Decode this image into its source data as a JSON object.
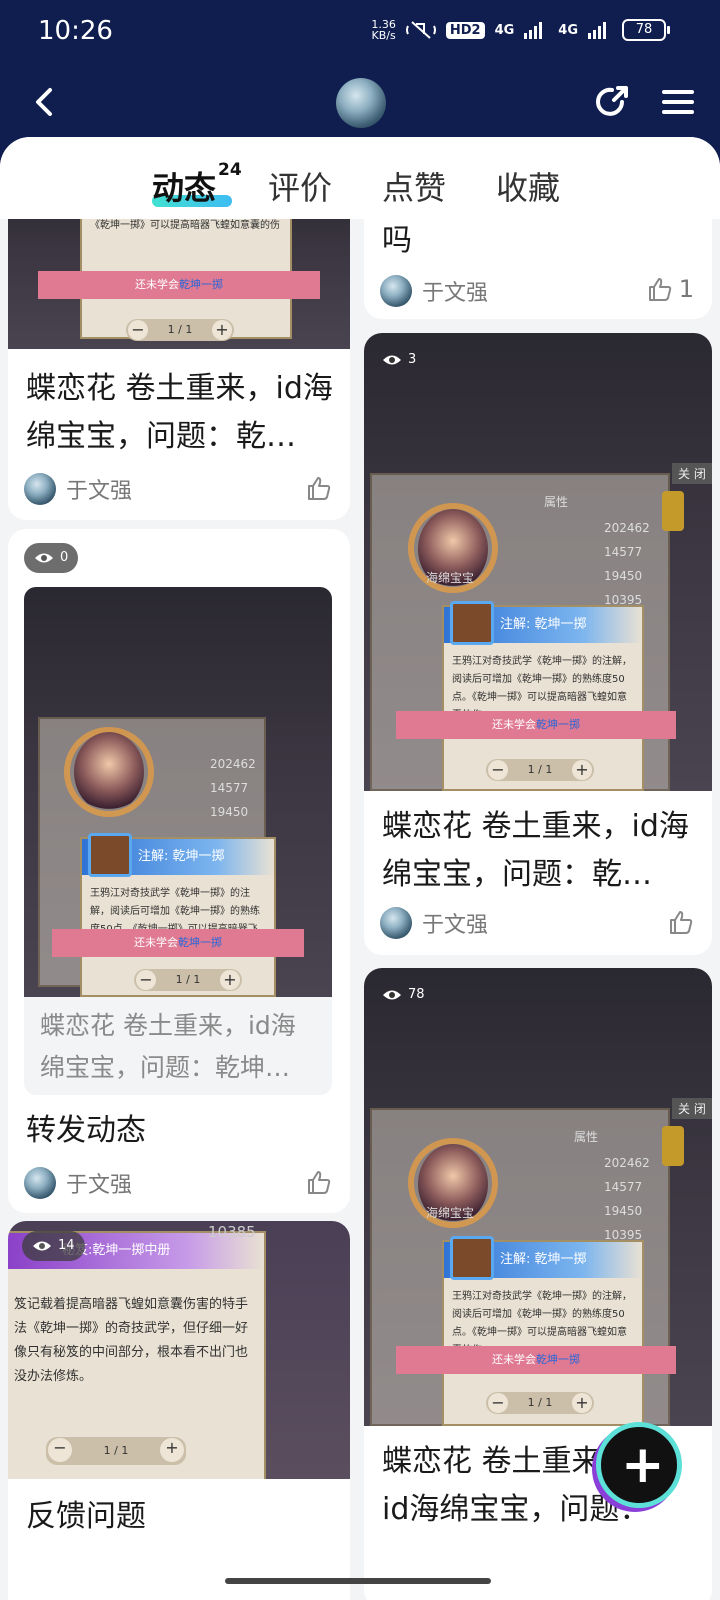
{
  "status_bar": {
    "time": "10:26",
    "net_speed_value": "1.36",
    "net_speed_unit": "KB/s",
    "hd": "HD2",
    "signal1": "4G",
    "signal2": "4G",
    "battery": "78"
  },
  "tabs": [
    {
      "label": "动态",
      "badge": "24",
      "active": true
    },
    {
      "label": "评价"
    },
    {
      "label": "点赞"
    },
    {
      "label": "收藏"
    }
  ],
  "game_text": {
    "note_title": "注解: 乾坤一掷",
    "note_body": "王鸦江对奇技武学《乾坤一掷》的注解，阅读后可增加《乾坤一掷》的熟练度50点。《乾坤一掷》可以提高暗器飞蝗如意囊的伤",
    "not_learned_prefix": "还未学会",
    "not_learned_skill": "乾坤一掷",
    "page": "1 / 1",
    "close": "关 闭",
    "attr": "属性",
    "char_name": "海绵宝宝",
    "stats": [
      "202462",
      "14577",
      "19450",
      "10395"
    ],
    "book_title": "秘笈:乾坤一掷中册",
    "book_body": "笈记载着提高暗器飞蝗如意囊伤害的特手法《乾坤一掷》的奇技武学，但仔细一好像只有秘笈的中间部分，根本看不出门也没办法修炼。",
    "bottom_stat": "10385"
  },
  "posts": {
    "left1": {
      "title": "蝶恋花 卷土重来，id海绵宝宝，问题：乾…",
      "author": "于文强"
    },
    "left2": {
      "views": "0",
      "repost_text": "蝶恋花 卷土重来，id海绵宝宝，问题：乾坤…",
      "title": "转发动态",
      "author": "于文强"
    },
    "left3": {
      "views": "14",
      "title": "反馈问题"
    },
    "right1": {
      "title_tail": "吗",
      "author": "于文强",
      "likes": "1"
    },
    "right2": {
      "views": "3",
      "title": "蝶恋花 卷土重来，id海绵宝宝，问题：乾…",
      "author": "于文强"
    },
    "right3": {
      "views": "78",
      "title": "蝶恋花 卷土重来，id海绵宝宝，问题：乾…"
    }
  },
  "fab_label": "+"
}
